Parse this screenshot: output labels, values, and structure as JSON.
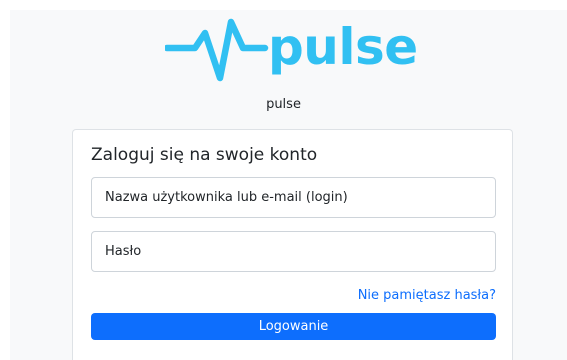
{
  "brand": {
    "logo_text": "pulse",
    "icon": "pulse-wave-icon",
    "color": "#31c0f2"
  },
  "subtitle": "pulse",
  "login_card": {
    "title": "Zaloguj się na swoje konto",
    "username": {
      "value": "",
      "placeholder": "Nazwa użytkownika lub e-mail (login)"
    },
    "password": {
      "value": "",
      "placeholder": "Hasło"
    },
    "forgot_password_label": "Nie pamiętasz hasła?",
    "submit_label": "Logowanie"
  },
  "colors": {
    "accent": "#0d6efd",
    "link": "#0d6efd",
    "page_background": "#f8f9fa",
    "card_border": "#dee2e6"
  }
}
